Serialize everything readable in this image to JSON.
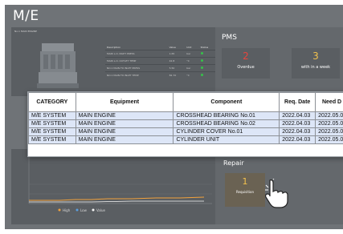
{
  "page_title": "M/E",
  "engine_panel": {
    "heading": "No.1 MAIN ENGINE",
    "columns": [
      "Description",
      "Value",
      "Unit",
      "Status"
    ],
    "rows": [
      {
        "desc": "MAIN L.O. INLET PRESS",
        "value": "1.65",
        "unit": "bar"
      },
      {
        "desc": "MAIN L.O. OUTLET TEMP",
        "value": "42.8",
        "unit": "°C"
      },
      {
        "desc": "NO.1 MAIN FO INLET PRESS",
        "value": "5.50",
        "unit": "bar"
      },
      {
        "desc": "NO.1 MAIN FO INLET TEMP",
        "value": "82.70",
        "unit": "°C"
      }
    ]
  },
  "pms": {
    "title": "PMS",
    "cards": [
      {
        "count": "2",
        "label": "Overdue",
        "color": "#e8453c"
      },
      {
        "count": "3",
        "label": "with in a week",
        "color": "#f2c14e"
      }
    ]
  },
  "requisition_table": {
    "columns": [
      "CATEGORY",
      "Equipment",
      "Component",
      "Req. Date",
      "Need D"
    ],
    "rows": [
      [
        "M/E SYSTEM",
        "MAIN ENGINE",
        "CROSSHEAD BEARING No.01",
        "2022.04.03",
        "2022.05.0"
      ],
      [
        "M/E SYSTEM",
        "MAIN ENGINE",
        "CROSSHEAD BEARING No.02",
        "2022.04.03",
        "2022.05.0"
      ],
      [
        "M/E SYSTEM",
        "MAIN ENGINE",
        "CYLINDER COVER No.01",
        "2022.04.03",
        "2022.05.0"
      ],
      [
        "M/E SYSTEM",
        "MAIN ENGINE",
        "CYLINDER UNIT",
        "2022.04.03",
        "2022.05.0"
      ]
    ]
  },
  "trend_chart": {
    "legend": [
      "High",
      "Low",
      "Value"
    ]
  },
  "repair": {
    "title": "Repair",
    "count": "1",
    "label": "Requisition"
  }
}
